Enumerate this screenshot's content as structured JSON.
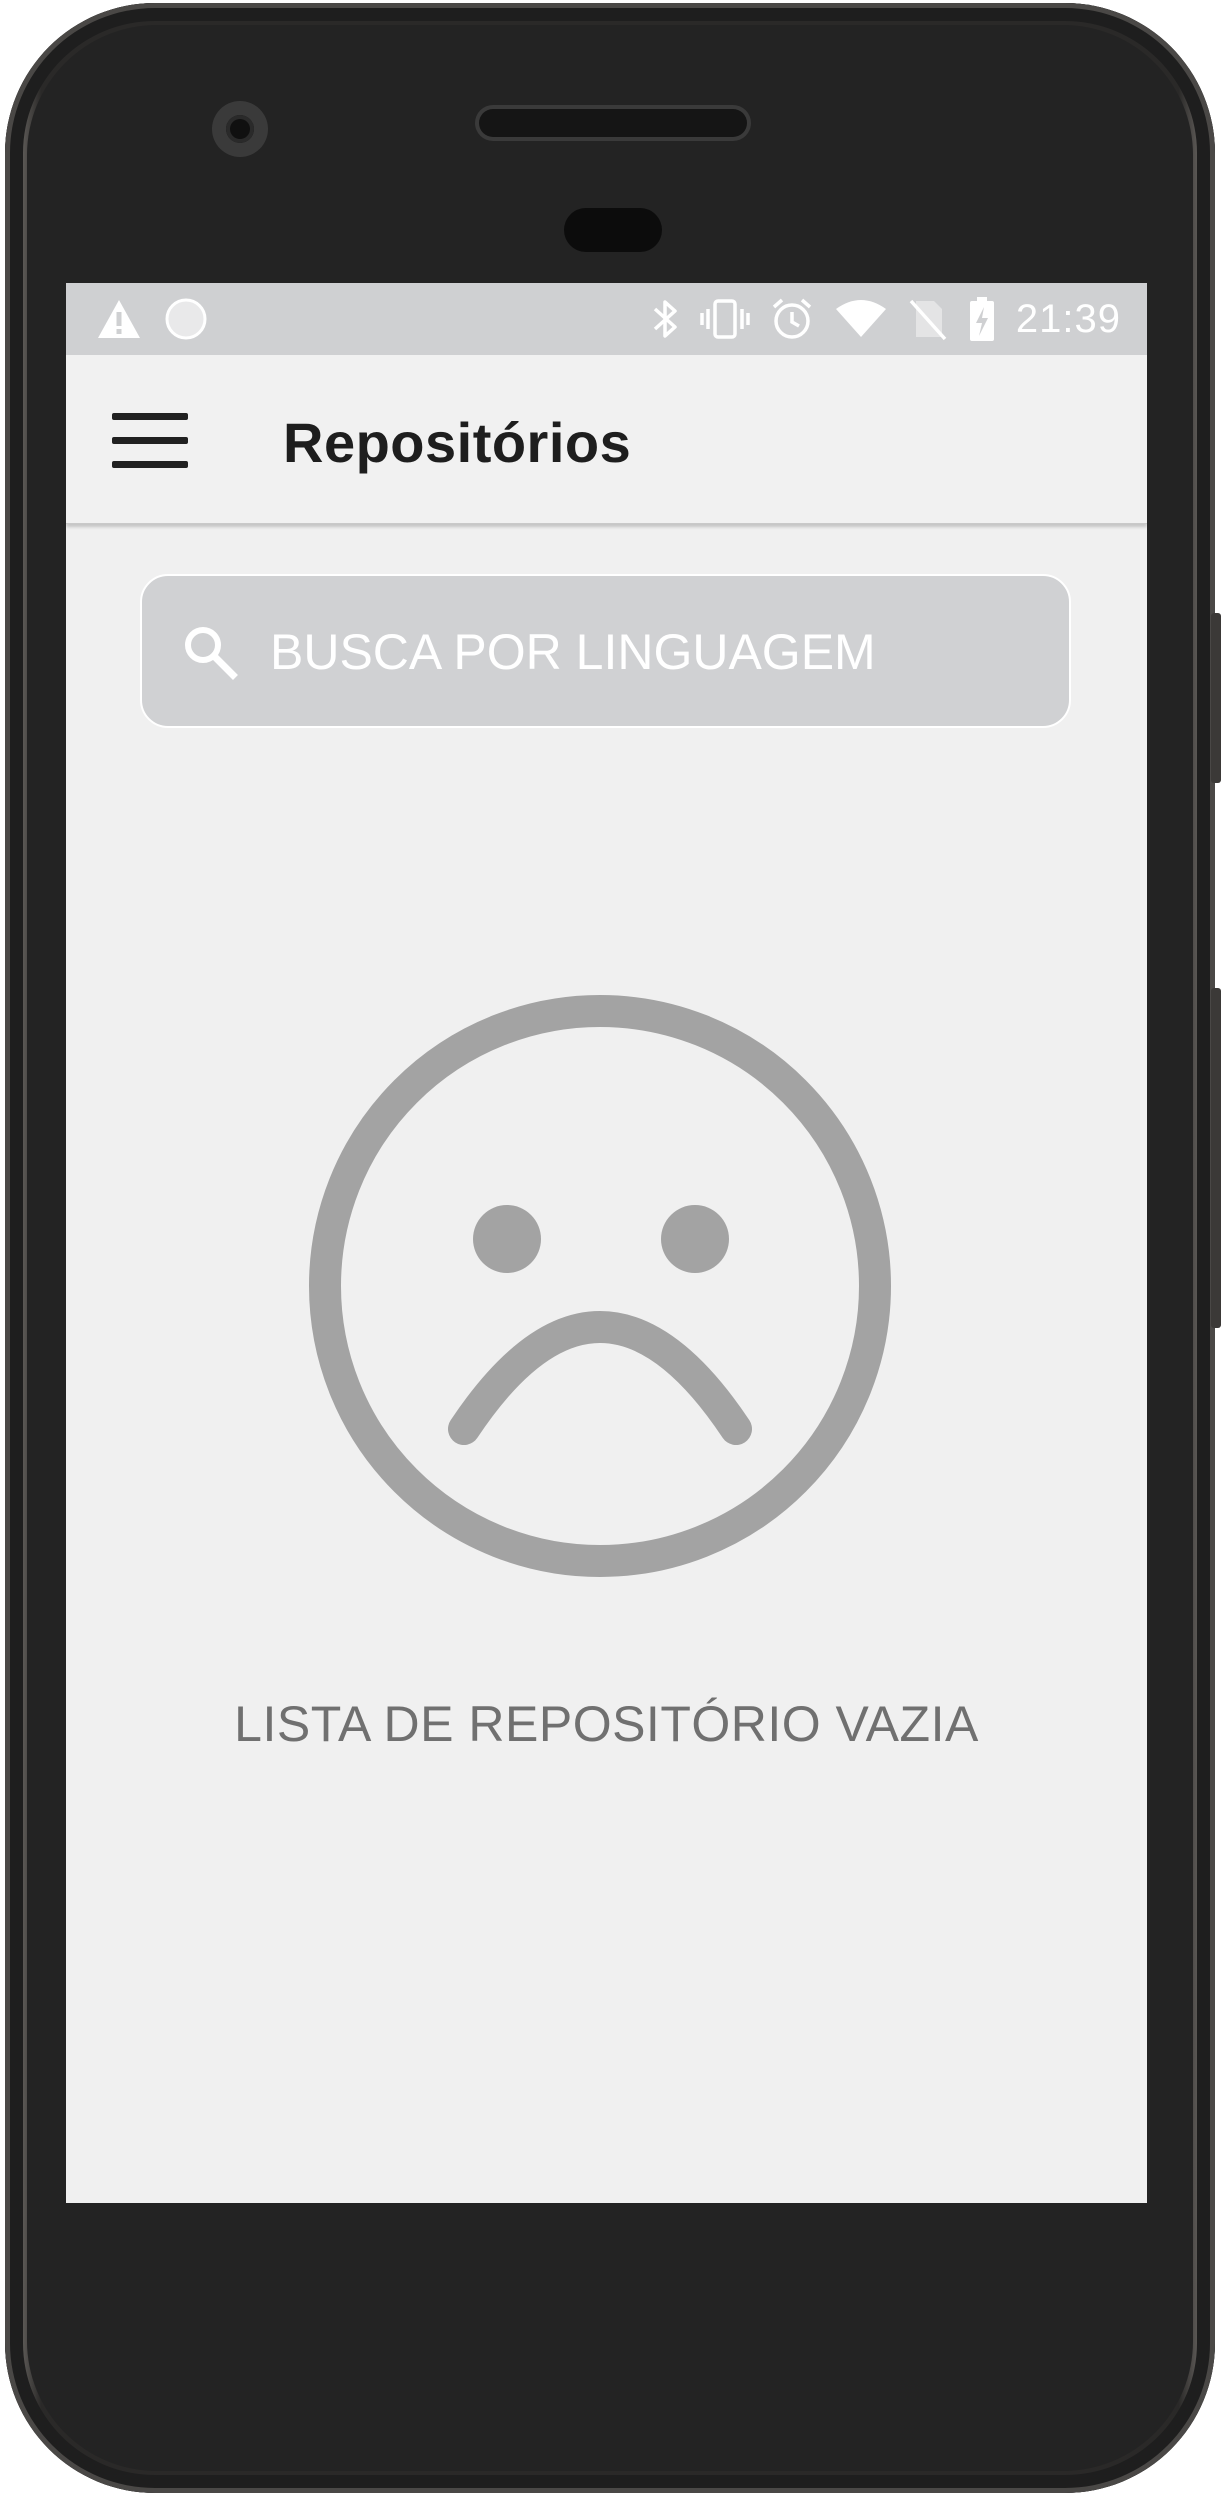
{
  "status_bar": {
    "time": "21:39",
    "left_icons": [
      "warning-icon",
      "circle-notification-icon"
    ],
    "right_icons": [
      "bluetooth-icon",
      "vibrate-icon",
      "alarm-icon",
      "wifi-icon",
      "no-sim-icon",
      "battery-charging-icon"
    ]
  },
  "app_bar": {
    "title": "Repositórios",
    "menu_icon": "hamburger-menu-icon"
  },
  "search": {
    "placeholder": "BUSCA POR LINGUAGEM",
    "value": "",
    "icon": "search-icon"
  },
  "empty_state": {
    "icon": "sad-face-icon",
    "message": "LISTA DE REPOSITÓRIO VAZIA"
  },
  "colors": {
    "status_bar_bg": "#cfd0d2",
    "screen_bg": "#f0f0f0",
    "search_bg": "#d0d1d3",
    "empty_icon": "#a3a3a3",
    "empty_text": "#707070",
    "title_text": "#1e1e1e"
  }
}
